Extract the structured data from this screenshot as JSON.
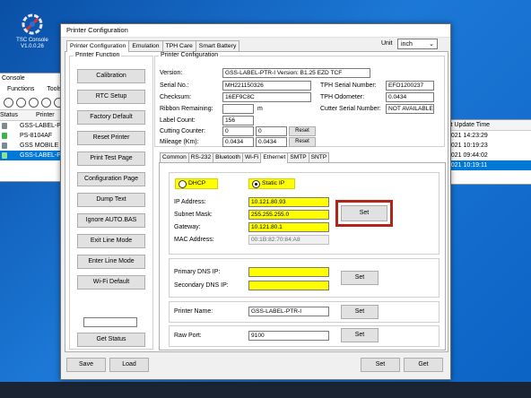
{
  "desktop": {
    "icon_label_1": "TSC Console",
    "icon_label_2": "V1.0.0.26"
  },
  "background_console": {
    "title": "Console",
    "menu": [
      "Functions",
      "Tools"
    ],
    "columns": [
      "Status",
      "Printer"
    ],
    "rows": [
      {
        "name": "GSS-LABEL-P..."
      },
      {
        "name": "PS-8104AF"
      },
      {
        "name": "GSS MOBILE P..."
      },
      {
        "name": "GSS-LABEL-P..."
      }
    ],
    "right_header": "st Update Time",
    "right_rows": [
      "2021 14:23:29",
      "2021 10:19:23",
      "2021 09:44:02",
      "2021 10:19:11"
    ]
  },
  "dialog": {
    "title": "Printer Configuration",
    "tabs": [
      "Printer Configuration",
      "Emulation",
      "TPH Care",
      "Smart Battery"
    ],
    "unit_label": "Unit",
    "unit_value": "inch",
    "printer_function": {
      "legend": "Printer Function",
      "buttons": [
        "Calibration",
        "RTC Setup",
        "Factory Default",
        "Reset Printer",
        "Print Test Page",
        "Configuration Page",
        "Dump Text",
        "Ignore AUTO.BAS",
        "Exit Line Mode",
        "Enter Line Mode",
        "Wi-Fi Default"
      ],
      "status_value": "",
      "get_status": "Get Status"
    },
    "printer_configuration": {
      "legend": "Printer Configuration",
      "version_label": "Version:",
      "version_value": "GSS-LABEL-PTR-I Version: B1.25 EZD TCF",
      "serial_label": "Serial No.:",
      "serial_value": "MH221150326",
      "checksum_label": "Checksum:",
      "checksum_value": "16EF9C8C",
      "ribbon_label": "Ribbon Remaining:",
      "ribbon_value": "",
      "ribbon_unit": "m",
      "label_count_label": "Label Count:",
      "label_count_value": "156",
      "cutting_label": "Cutting Counter:",
      "cutting_value_1": "0",
      "cutting_value_2": "0",
      "mileage_label": "Mileage (Km):",
      "mileage_value_1": "0.0434",
      "mileage_value_2": "0.0434",
      "reset_label": "Reset",
      "tph_serial_label": "TPH Serial Number:",
      "tph_serial_value": "EFO1200237",
      "tph_odometer_label": "TPH Odometer:",
      "tph_odometer_value": "0.0434",
      "cutter_serial_label": "Cutter Serial Number:",
      "cutter_serial_value": "NOT AVAILABLE"
    },
    "sub_tabs": [
      "Common",
      "RS-232",
      "Bluetooth",
      "Wi-Fi",
      "Ethernet",
      "SMTP",
      "SNTP"
    ],
    "ethernet": {
      "dhcp_label": "DHCP",
      "static_label": "Static IP",
      "ip_label": "IP Address:",
      "ip_value": "10.121.80.93",
      "subnet_label": "Subnet Mask:",
      "subnet_value": "255.255.255.0",
      "gateway_label": "Gateway:",
      "gateway_value": "10.121.80.1",
      "mac_label": "MAC Address:",
      "mac_value": "00:1B:82:70:84:A8",
      "set_label": "Set",
      "primary_dns_label": "Primary DNS IP:",
      "primary_dns_value": "",
      "secondary_dns_label": "Secondary DNS IP:",
      "secondary_dns_value": "",
      "printer_name_label": "Printer Name:",
      "printer_name_value": "GSS-LABEL-PTR-I",
      "raw_port_label": "Raw Port:",
      "raw_port_value": "9100"
    },
    "footer": {
      "save": "Save",
      "load": "Load",
      "set": "Set",
      "get": "Get"
    }
  },
  "colors": {
    "highlight": "#b0261d",
    "yellow_field": "#ffff00",
    "selection": "#0078d7"
  }
}
